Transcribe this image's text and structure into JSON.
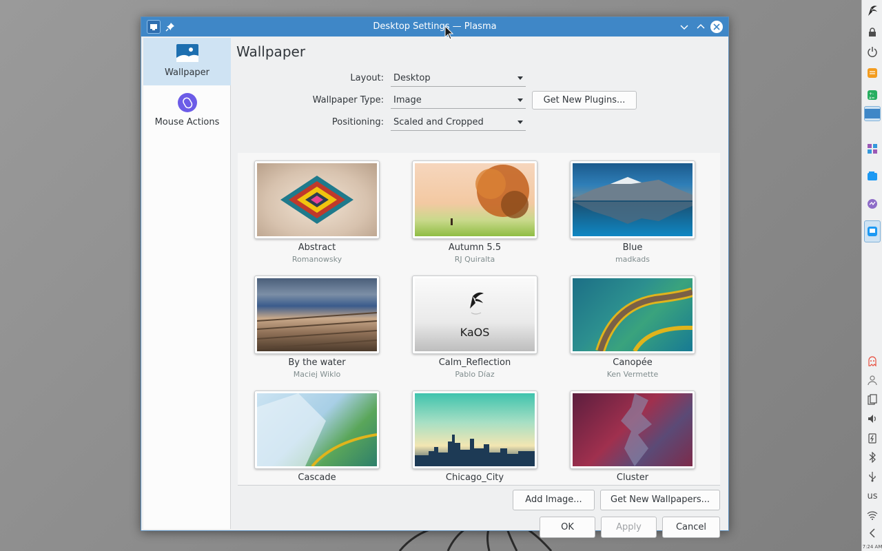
{
  "window": {
    "title": "Desktop Settings — Plasma",
    "accent_color": "#3f87c7"
  },
  "sidebar": {
    "items": [
      {
        "label": "Wallpaper",
        "icon": "wallpaper-icon",
        "selected": true
      },
      {
        "label": "Mouse Actions",
        "icon": "mouse-actions-icon",
        "selected": false
      }
    ]
  },
  "main": {
    "heading": "Wallpaper",
    "layout": {
      "label": "Layout:",
      "value": "Desktop"
    },
    "wallpaper_type": {
      "label": "Wallpaper Type:",
      "value": "Image"
    },
    "positioning": {
      "label": "Positioning:",
      "value": "Scaled and Cropped"
    },
    "get_new_plugins": "Get New Plugins...",
    "wallpapers": [
      {
        "name": "Abstract",
        "author": "Romanowsky"
      },
      {
        "name": "Autumn 5.5",
        "author": "RJ Quiralta"
      },
      {
        "name": "Blue",
        "author": "madkads"
      },
      {
        "name": "By the water",
        "author": "Maciej Wiklo"
      },
      {
        "name": "Calm_Reflection",
        "author": "Pablo Díaz",
        "overlay_text": "KaOS"
      },
      {
        "name": "Canopée",
        "author": "Ken Vermette"
      },
      {
        "name": "Cascade",
        "author": ""
      },
      {
        "name": "Chicago_City",
        "author": ""
      },
      {
        "name": "Cluster",
        "author": ""
      }
    ],
    "add_image": "Add Image...",
    "get_new_wallpapers": "Get New Wallpapers..."
  },
  "footer": {
    "ok": "OK",
    "apply": "Apply",
    "cancel": "Cancel"
  },
  "panel": {
    "keyboard_layout": "us",
    "clock": "7:24 AM"
  }
}
